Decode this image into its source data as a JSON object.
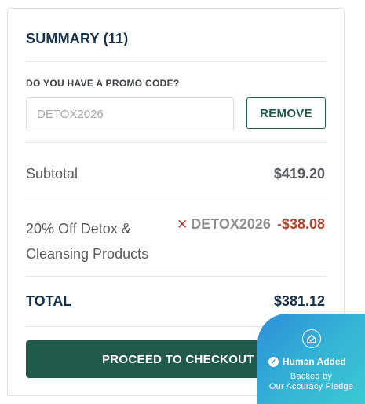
{
  "summary": {
    "title": "SUMMARY (11)"
  },
  "promo": {
    "label": "DO YOU HAVE A PROMO CODE?",
    "placeholder": "DETOX2026",
    "value": "",
    "remove_label": "REMOVE"
  },
  "subtotal": {
    "label": "Subtotal",
    "value": "$419.20"
  },
  "discount": {
    "label": "20% Off Detox & Cleansing Products",
    "code": "DETOX2026",
    "amount": "-$38.08",
    "remove_icon": "close-icon"
  },
  "total": {
    "label": "TOTAL",
    "value": "$381.12"
  },
  "checkout": {
    "label": "PROCEED TO CHECKOUT"
  },
  "badge": {
    "title": "Human Added",
    "line1": "Backed by",
    "line2": "Our Accuracy Pledge",
    "icon": "home-shield-icon"
  },
  "colors": {
    "brand": "#1f5a4c",
    "discount": "#b5432d",
    "remove_x": "#c0392b",
    "badge_start": "#2d8ed8",
    "badge_end": "#3cc9d2"
  }
}
